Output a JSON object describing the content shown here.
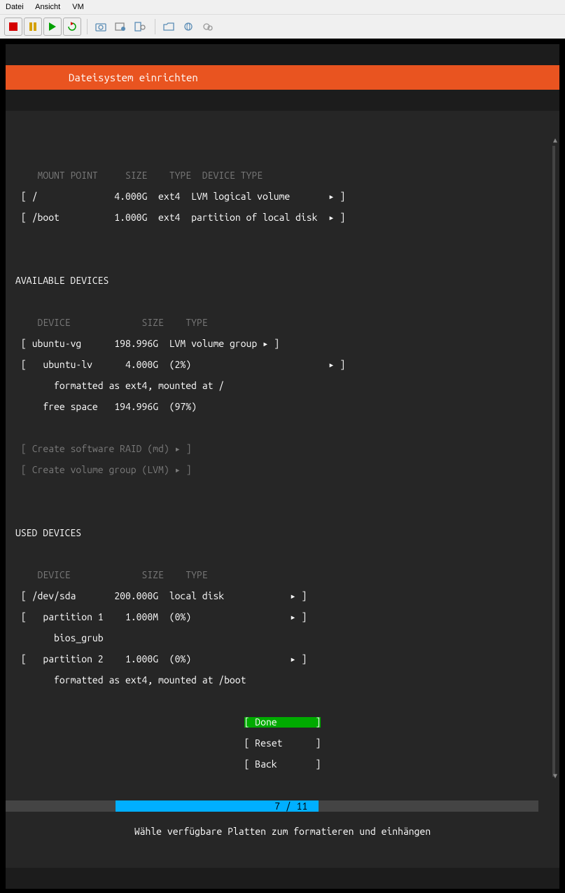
{
  "menubar": {
    "file": "Datei",
    "view": "Ansicht",
    "vm": "VM"
  },
  "toolbar": {
    "stop": "stop",
    "pause": "pause",
    "play": "play",
    "refresh": "refresh",
    "snapshot": "snapshot",
    "screenshot": "screenshot",
    "devices": "devices",
    "folder": "folder",
    "network": "network",
    "settings": "settings"
  },
  "header": {
    "title": "Dateisystem einrichten"
  },
  "filesystems": {
    "cols": {
      "mount": "MOUNT POINT",
      "size": "SIZE",
      "type": "TYPE",
      "devtype": "DEVICE TYPE"
    },
    "rows": [
      {
        "mount": "/",
        "size": "4.000G",
        "type": "ext4",
        "devtype": "LVM logical volume"
      },
      {
        "mount": "/boot",
        "size": "1.000G",
        "type": "ext4",
        "devtype": "partition of local disk"
      }
    ]
  },
  "available": {
    "title": "AVAILABLE DEVICES",
    "cols": {
      "device": "DEVICE",
      "size": "SIZE",
      "type": "TYPE"
    },
    "rows": [
      {
        "device": "ubuntu-vg",
        "size": "198.996G",
        "type": "LVM volume group",
        "arrow": true
      },
      {
        "device": "ubuntu-lv",
        "size": "4.000G",
        "type": "(2%)",
        "indent": true,
        "arrow": true
      },
      {
        "note": "formatted as ext4, mounted at /"
      },
      {
        "device": "free space",
        "size": "194.996G",
        "type": "(97%)",
        "indent": true
      }
    ],
    "actions": [
      {
        "label": "Create software RAID (md)"
      },
      {
        "label": "Create volume group (LVM)"
      }
    ]
  },
  "used": {
    "title": "USED DEVICES",
    "cols": {
      "device": "DEVICE",
      "size": "SIZE",
      "type": "TYPE"
    },
    "rows": [
      {
        "device": "/dev/sda",
        "size": "200.000G",
        "type": "local disk",
        "arrow": true
      },
      {
        "device": "partition 1",
        "size": "1.000M",
        "type": "(0%)",
        "indent": true,
        "arrow": true
      },
      {
        "note": "bios_grub"
      },
      {
        "device": "partition 2",
        "size": "1.000G",
        "type": "(0%)",
        "indent": true,
        "arrow": true
      },
      {
        "note": "formatted as ext4, mounted at /boot"
      }
    ]
  },
  "buttons": {
    "done": "Done",
    "reset": "Reset",
    "back": "Back"
  },
  "progress": {
    "text": "7 / 11"
  },
  "footer": {
    "hint": "Wähle verfügbare Platten zum formatieren und einhängen"
  }
}
